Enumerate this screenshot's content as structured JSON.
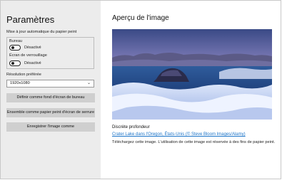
{
  "window": {
    "controls": {
      "minimize": "—",
      "maximize": "☐",
      "close": "✕"
    }
  },
  "sidebar": {
    "title": "Paramètres",
    "auto_update_label": "Mise à jour automatique du papier peint",
    "desktop": {
      "label": "Bureau",
      "state": "Désactivé",
      "on": false
    },
    "lockscreen": {
      "label": "Écran de verrouillage",
      "state": "Désactivé",
      "on": false
    },
    "resolution": {
      "label": "Résolution préférée",
      "value": "1920x1080"
    },
    "buttons": {
      "set_desktop": "Définir comme fond d'écran de bureau",
      "set_both": "Ensemble comme papier peint d'écran de serrure",
      "save_image": "Enregistrer l'image comme"
    }
  },
  "main": {
    "title": "Aperçu de l'image",
    "caption": "Discrète profondeur",
    "link": "Crater Lake dans l'Oregon, États-Unis (© Steve Bloom Images/Alamy)",
    "note": "Téléchargez cette image. L'utilisation de cette image est réservée à des fins de papier peint."
  },
  "colors": {
    "sidebar_bg": "#ececec",
    "button_bg": "#cfcfcf",
    "link": "#1a73c8"
  }
}
